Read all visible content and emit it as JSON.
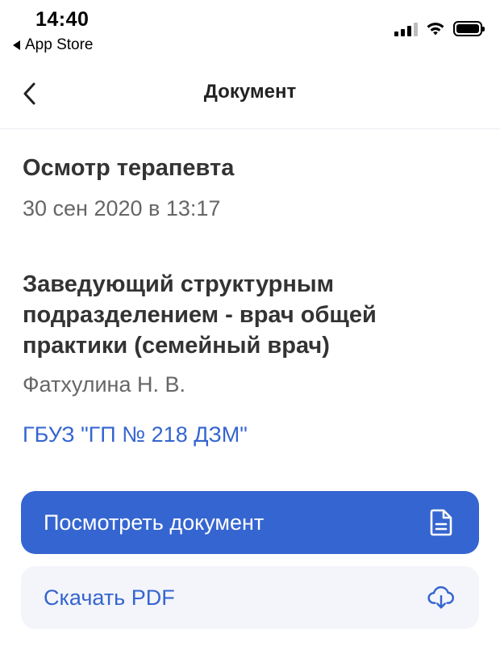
{
  "status_bar": {
    "time": "14:40",
    "back_label": "App Store"
  },
  "nav": {
    "title": "Документ",
    "back_icon": "chevron-left-icon"
  },
  "document": {
    "title": "Осмотр терапевта",
    "date": "30 сен 2020 в 13:17",
    "doctor_position": "Заведующий структурным подразделением - врач общей практики (семейный врач)",
    "doctor_name": "Фатхулина Н. В.",
    "clinic": "ГБУЗ \"ГП № 218 ДЗМ\""
  },
  "actions": {
    "view_label": "Посмотреть документ",
    "view_icon": "document-icon",
    "download_label": "Скачать PDF",
    "download_icon": "cloud-download-icon"
  },
  "colors": {
    "accent": "#3565d0",
    "secondary_bg": "#f3f5fa"
  }
}
